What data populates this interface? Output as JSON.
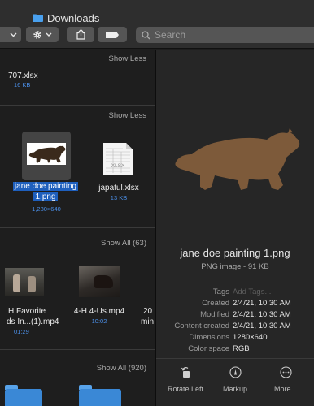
{
  "window": {
    "title": "Downloads",
    "search_placeholder": "Search"
  },
  "browser": {
    "section_1": {
      "link": "Show Less",
      "file": {
        "name": "707.xlsx",
        "size": "16 KB"
      }
    },
    "section_2": {
      "link": "Show Less",
      "files": [
        {
          "name_line1": "jane doe painting",
          "name_line2": "1.png",
          "meta": "1,280×640",
          "selected": true
        },
        {
          "name_line1": "japatul.xlsx",
          "meta": "13 KB"
        }
      ]
    },
    "section_3": {
      "link": "Show All (63)",
      "files": [
        {
          "name_line1": "H Favorite",
          "name_line2": "ds In...(1).mp4",
          "meta": "01:29"
        },
        {
          "name_line1": "4-H 4-Us.mp4",
          "meta": "10:02"
        },
        {
          "name_line1": "20",
          "name_line2": "min"
        }
      ]
    },
    "section_4": {
      "link": "Show All (920)"
    }
  },
  "preview": {
    "title": "jane doe painting 1.png",
    "subtitle": "PNG image - 91 KB",
    "info": [
      {
        "label": "Tags",
        "value": "Add Tags...",
        "placeholder": true
      },
      {
        "label": "Created",
        "value": "2/4/21, 10:30 AM"
      },
      {
        "label": "Modified",
        "value": "2/4/21, 10:30 AM"
      },
      {
        "label": "Content created",
        "value": "2/4/21, 10:30 AM"
      },
      {
        "label": "Dimensions",
        "value": "1280×640"
      },
      {
        "label": "Color space",
        "value": "RGB"
      }
    ],
    "actions": [
      {
        "label": "Rotate Left",
        "icon": "rotate-left-icon"
      },
      {
        "label": "Markup",
        "icon": "markup-icon"
      },
      {
        "label": "More...",
        "icon": "more-icon"
      }
    ]
  },
  "colors": {
    "accent": "#1e5fbd",
    "meta_blue": "#4b8fe8",
    "bear_brown": "#7d5a3a",
    "folder_blue": "#3a88d6"
  }
}
